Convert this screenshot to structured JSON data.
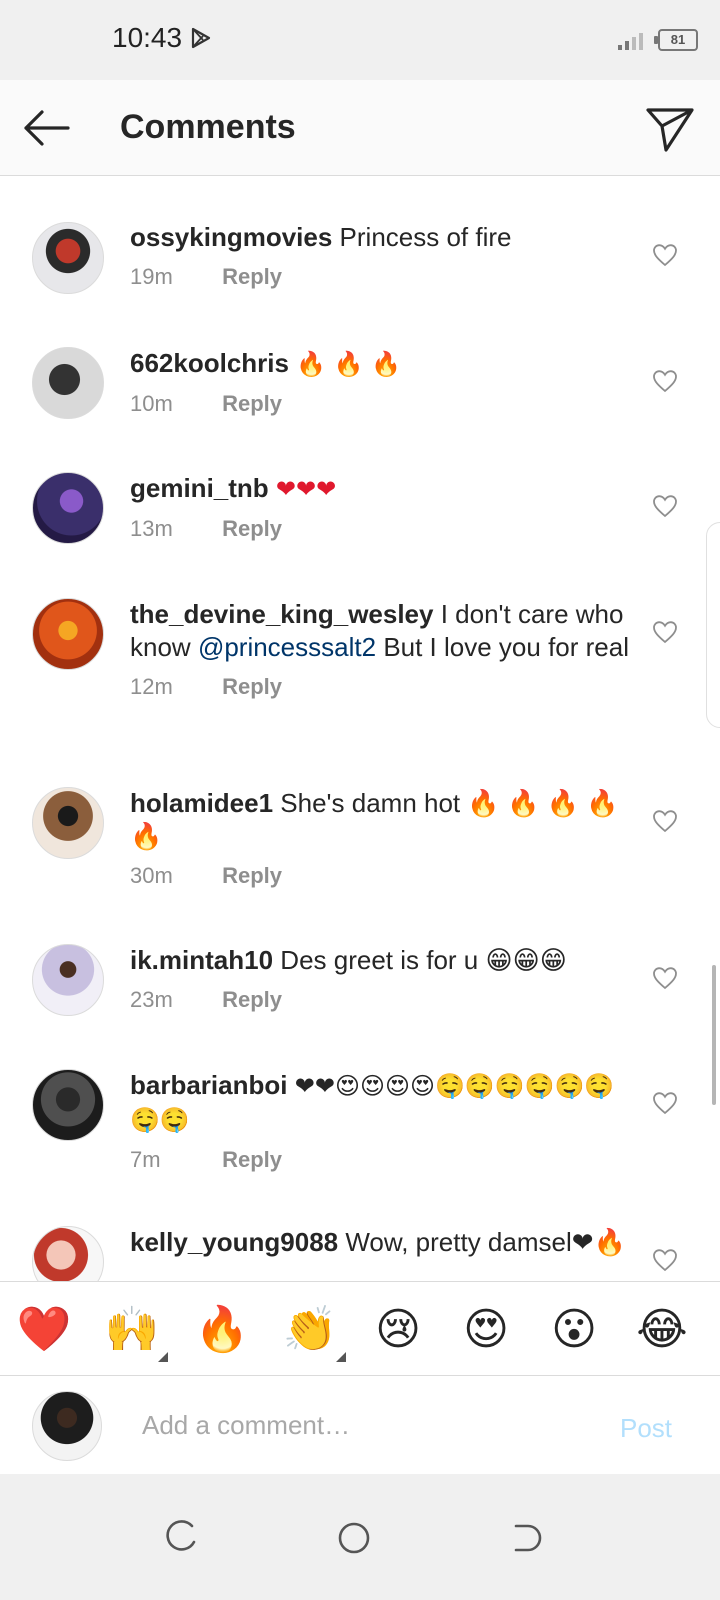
{
  "status_bar": {
    "time": "10:43",
    "battery": "81"
  },
  "header": {
    "title": "Comments"
  },
  "comments": [
    {
      "username": "ossykingmovies",
      "text": "Princess of fire",
      "time": "19m",
      "reply": "Reply"
    },
    {
      "username": "662koolchris",
      "text": "🔥 🔥 🔥",
      "time": "10m",
      "reply": "Reply"
    },
    {
      "username": "gemini_tnb",
      "text": "❤❤❤",
      "time": "13m",
      "reply": "Reply"
    },
    {
      "username": "the_devine_king_wesley",
      "text_before": "I don't care who know",
      "mention": "@princesssalt2",
      "text_after": "But I love you for real",
      "time": "12m",
      "reply": "Reply"
    },
    {
      "username": "holamidee1",
      "text": "She's damn hot 🔥 🔥 🔥 🔥 🔥",
      "time": "30m",
      "reply": "Reply"
    },
    {
      "username": "ik.mintah10",
      "text": "Des greet is for u 😁😁😁",
      "time": "23m",
      "reply": "Reply"
    },
    {
      "username": "barbarianboi",
      "text": "❤❤😍😍😍😍🤤🤤🤤🤤🤤🤤🤤🤤",
      "time": "7m",
      "reply": "Reply"
    },
    {
      "username": "kelly_young9088",
      "text": "Wow, pretty damsel❤🔥",
      "time": "",
      "reply": ""
    }
  ],
  "quick_emojis": [
    "❤️",
    "🙌",
    "🔥",
    "👏",
    "😢",
    "😍",
    "😮",
    "😂"
  ],
  "input": {
    "placeholder": "Add a comment…",
    "post_label": "Post"
  },
  "icons": {
    "back": "arrow-left-icon",
    "send": "paper-plane-icon",
    "like": "heart-outline-icon"
  },
  "colors": {
    "mention": "#003569",
    "post_disabled": "#b2dffc",
    "meta": "#8e8e8e"
  }
}
